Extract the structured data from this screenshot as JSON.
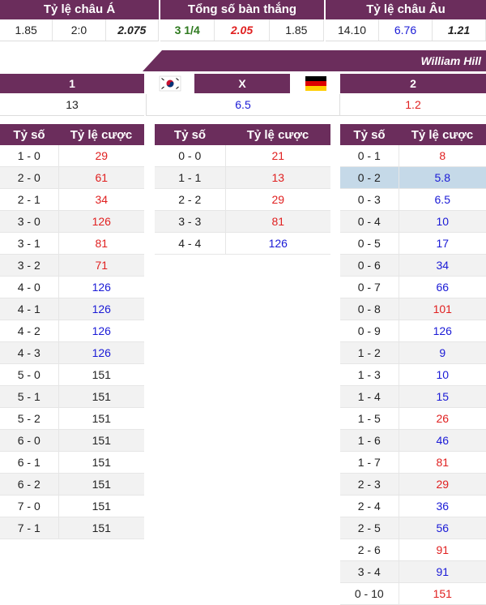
{
  "top_odds": {
    "headers": [
      "Tỷ lệ châu Á",
      "Tổng số bàn thắng",
      "Tỷ lệ châu Âu"
    ],
    "asia": [
      "1.85",
      "2:0",
      "2.075"
    ],
    "total": [
      "3 1/4",
      "2.05",
      "1.85"
    ],
    "europe": [
      "14.10",
      "6.76",
      "1.21"
    ]
  },
  "bookmaker": "William Hill",
  "outcome": {
    "labels": [
      "1",
      "X",
      "2"
    ],
    "values": [
      "13",
      "6.5",
      "1.2"
    ],
    "home_flag": "korea-flag-icon",
    "away_flag": "germany-flag-icon"
  },
  "colors": {
    "header": "#6b2d5c",
    "red": "#e02020",
    "blue": "#1a1ad6",
    "highlight": "#c5d9e8"
  },
  "tables": {
    "col_score": "Tỷ số",
    "col_odds": "Tỷ lệ cược",
    "home_win": [
      {
        "score": "1 - 0",
        "odds": "29",
        "color": "red"
      },
      {
        "score": "2 - 0",
        "odds": "61",
        "color": "red"
      },
      {
        "score": "2 - 1",
        "odds": "34",
        "color": "red"
      },
      {
        "score": "3 - 0",
        "odds": "126",
        "color": "red"
      },
      {
        "score": "3 - 1",
        "odds": "81",
        "color": "red"
      },
      {
        "score": "3 - 2",
        "odds": "71",
        "color": "red"
      },
      {
        "score": "4 - 0",
        "odds": "126",
        "color": "blue"
      },
      {
        "score": "4 - 1",
        "odds": "126",
        "color": "blue"
      },
      {
        "score": "4 - 2",
        "odds": "126",
        "color": "blue"
      },
      {
        "score": "4 - 3",
        "odds": "126",
        "color": "blue"
      },
      {
        "score": "5 - 0",
        "odds": "151",
        "color": "black"
      },
      {
        "score": "5 - 1",
        "odds": "151",
        "color": "black"
      },
      {
        "score": "5 - 2",
        "odds": "151",
        "color": "black"
      },
      {
        "score": "6 - 0",
        "odds": "151",
        "color": "black"
      },
      {
        "score": "6 - 1",
        "odds": "151",
        "color": "black"
      },
      {
        "score": "6 - 2",
        "odds": "151",
        "color": "black"
      },
      {
        "score": "7 - 0",
        "odds": "151",
        "color": "black"
      },
      {
        "score": "7 - 1",
        "odds": "151",
        "color": "black"
      }
    ],
    "draw": [
      {
        "score": "0 - 0",
        "odds": "21",
        "color": "red"
      },
      {
        "score": "1 - 1",
        "odds": "13",
        "color": "red"
      },
      {
        "score": "2 - 2",
        "odds": "29",
        "color": "red"
      },
      {
        "score": "3 - 3",
        "odds": "81",
        "color": "red"
      },
      {
        "score": "4 - 4",
        "odds": "126",
        "color": "blue"
      }
    ],
    "away_win": [
      {
        "score": "0 - 1",
        "odds": "8",
        "color": "red"
      },
      {
        "score": "0 - 2",
        "odds": "5.8",
        "color": "blue",
        "highlight": true
      },
      {
        "score": "0 - 3",
        "odds": "6.5",
        "color": "blue"
      },
      {
        "score": "0 - 4",
        "odds": "10",
        "color": "blue"
      },
      {
        "score": "0 - 5",
        "odds": "17",
        "color": "blue"
      },
      {
        "score": "0 - 6",
        "odds": "34",
        "color": "blue"
      },
      {
        "score": "0 - 7",
        "odds": "66",
        "color": "blue"
      },
      {
        "score": "0 - 8",
        "odds": "101",
        "color": "red"
      },
      {
        "score": "0 - 9",
        "odds": "126",
        "color": "blue"
      },
      {
        "score": "1 - 2",
        "odds": "9",
        "color": "blue"
      },
      {
        "score": "1 - 3",
        "odds": "10",
        "color": "blue"
      },
      {
        "score": "1 - 4",
        "odds": "15",
        "color": "blue"
      },
      {
        "score": "1 - 5",
        "odds": "26",
        "color": "red"
      },
      {
        "score": "1 - 6",
        "odds": "46",
        "color": "blue"
      },
      {
        "score": "1 - 7",
        "odds": "81",
        "color": "red"
      },
      {
        "score": "2 - 3",
        "odds": "29",
        "color": "red"
      },
      {
        "score": "2 - 4",
        "odds": "36",
        "color": "blue"
      },
      {
        "score": "2 - 5",
        "odds": "56",
        "color": "blue"
      },
      {
        "score": "2 - 6",
        "odds": "91",
        "color": "red"
      },
      {
        "score": "3 - 4",
        "odds": "91",
        "color": "blue"
      },
      {
        "score": "0 - 10",
        "odds": "151",
        "color": "red"
      }
    ]
  }
}
